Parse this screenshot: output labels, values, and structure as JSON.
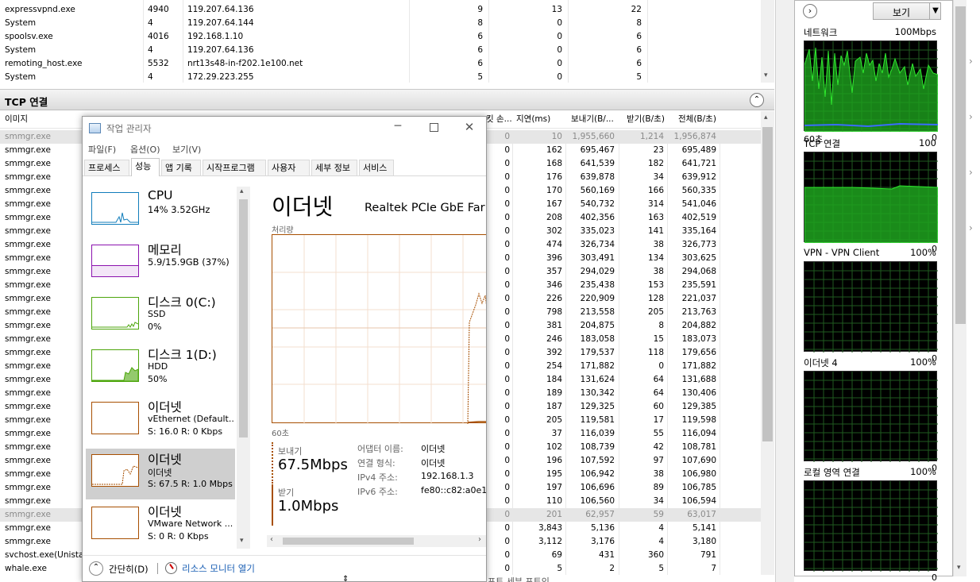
{
  "top_table": {
    "rows": [
      {
        "image": "expressvpnd.exe",
        "pid": "4940",
        "address": "119.207.64.136",
        "c1": "9",
        "c2": "13",
        "c3": "22"
      },
      {
        "image": "System",
        "pid": "4",
        "address": "119.207.64.144",
        "c1": "8",
        "c2": "0",
        "c3": "8"
      },
      {
        "image": "spoolsv.exe",
        "pid": "4016",
        "address": "192.168.1.10",
        "c1": "6",
        "c2": "0",
        "c3": "6"
      },
      {
        "image": "System",
        "pid": "4",
        "address": "119.207.64.136",
        "c1": "6",
        "c2": "0",
        "c3": "6"
      },
      {
        "image": "remoting_host.exe",
        "pid": "5532",
        "address": "nrt13s48-in-f202.1e100.net",
        "c1": "6",
        "c2": "0",
        "c3": "6"
      },
      {
        "image": "System",
        "pid": "4",
        "address": "172.29.223.255",
        "c1": "5",
        "c2": "0",
        "c3": "5"
      }
    ]
  },
  "tcp": {
    "title": "TCP 연결",
    "col_image": "이미지",
    "col_loss": "킷 손...",
    "col_latency": "지연(ms)",
    "col_send": "보내기(B/...",
    "col_recv": "받기(B/초)",
    "col_total": "전체(B/초)",
    "rows": [
      {
        "image": "smmgr.exe",
        "loss": "0",
        "latency": "10",
        "send": "1,955,660",
        "recv": "1,214",
        "total": "1,956,874",
        "dim": true
      },
      {
        "image": "smmgr.exe",
        "loss": "0",
        "latency": "162",
        "send": "695,467",
        "recv": "23",
        "total": "695,489"
      },
      {
        "image": "smmgr.exe",
        "loss": "0",
        "latency": "168",
        "send": "641,539",
        "recv": "182",
        "total": "641,721"
      },
      {
        "image": "smmgr.exe",
        "loss": "0",
        "latency": "176",
        "send": "639,878",
        "recv": "34",
        "total": "639,912"
      },
      {
        "image": "smmgr.exe",
        "loss": "0",
        "latency": "170",
        "send": "560,169",
        "recv": "166",
        "total": "560,335"
      },
      {
        "image": "smmgr.exe",
        "loss": "0",
        "latency": "167",
        "send": "540,732",
        "recv": "314",
        "total": "541,046"
      },
      {
        "image": "smmgr.exe",
        "loss": "0",
        "latency": "208",
        "send": "402,356",
        "recv": "163",
        "total": "402,519"
      },
      {
        "image": "smmgr.exe",
        "loss": "0",
        "latency": "302",
        "send": "335,023",
        "recv": "141",
        "total": "335,164"
      },
      {
        "image": "smmgr.exe",
        "loss": "0",
        "latency": "474",
        "send": "326,734",
        "recv": "38",
        "total": "326,773"
      },
      {
        "image": "smmgr.exe",
        "loss": "0",
        "latency": "396",
        "send": "303,491",
        "recv": "134",
        "total": "303,625"
      },
      {
        "image": "smmgr.exe",
        "loss": "0",
        "latency": "357",
        "send": "294,029",
        "recv": "38",
        "total": "294,068"
      },
      {
        "image": "smmgr.exe",
        "loss": "0",
        "latency": "346",
        "send": "235,438",
        "recv": "153",
        "total": "235,591"
      },
      {
        "image": "smmgr.exe",
        "loss": "0",
        "latency": "226",
        "send": "220,909",
        "recv": "128",
        "total": "221,037"
      },
      {
        "image": "smmgr.exe",
        "loss": "0",
        "latency": "798",
        "send": "213,558",
        "recv": "205",
        "total": "213,763"
      },
      {
        "image": "smmgr.exe",
        "loss": "0",
        "latency": "381",
        "send": "204,875",
        "recv": "8",
        "total": "204,882"
      },
      {
        "image": "smmgr.exe",
        "loss": "0",
        "latency": "246",
        "send": "183,058",
        "recv": "15",
        "total": "183,073"
      },
      {
        "image": "smmgr.exe",
        "loss": "0",
        "latency": "392",
        "send": "179,537",
        "recv": "118",
        "total": "179,656"
      },
      {
        "image": "smmgr.exe",
        "loss": "0",
        "latency": "254",
        "send": "171,882",
        "recv": "0",
        "total": "171,882"
      },
      {
        "image": "smmgr.exe",
        "loss": "0",
        "latency": "184",
        "send": "131,624",
        "recv": "64",
        "total": "131,688"
      },
      {
        "image": "smmgr.exe",
        "loss": "0",
        "latency": "189",
        "send": "130,342",
        "recv": "64",
        "total": "130,406"
      },
      {
        "image": "smmgr.exe",
        "loss": "0",
        "latency": "187",
        "send": "129,325",
        "recv": "60",
        "total": "129,385"
      },
      {
        "image": "smmgr.exe",
        "loss": "0",
        "latency": "205",
        "send": "119,581",
        "recv": "17",
        "total": "119,598"
      },
      {
        "image": "smmgr.exe",
        "loss": "0",
        "latency": "37",
        "send": "116,039",
        "recv": "55",
        "total": "116,094"
      },
      {
        "image": "smmgr.exe",
        "loss": "0",
        "latency": "102",
        "send": "108,739",
        "recv": "42",
        "total": "108,781"
      },
      {
        "image": "smmgr.exe",
        "loss": "0",
        "latency": "196",
        "send": "107,592",
        "recv": "97",
        "total": "107,690"
      },
      {
        "image": "smmgr.exe",
        "loss": "0",
        "latency": "195",
        "send": "106,942",
        "recv": "38",
        "total": "106,980"
      },
      {
        "image": "smmgr.exe",
        "loss": "0",
        "latency": "197",
        "send": "106,696",
        "recv": "89",
        "total": "106,785"
      },
      {
        "image": "smmgr.exe",
        "loss": "0",
        "latency": "110",
        "send": "106,560",
        "recv": "34",
        "total": "106,594"
      },
      {
        "image": "smmgr.exe",
        "loss": "0",
        "latency": "201",
        "send": "62,957",
        "recv": "59",
        "total": "63,017",
        "dim": true
      },
      {
        "image": "smmgr.exe",
        "loss": "0",
        "latency": "3,843",
        "send": "5,136",
        "recv": "4",
        "total": "5,141"
      },
      {
        "image": "smmgr.exe",
        "loss": "0",
        "latency": "3,112",
        "send": "3,176",
        "recv": "4",
        "total": "3,180"
      },
      {
        "image": "svchost.exe(Unistac",
        "loss": "0",
        "latency": "69",
        "send": "431",
        "recv": "360",
        "total": "791"
      },
      {
        "image": "whale.exe",
        "loss": "0",
        "latency": "5",
        "send": "2",
        "recv": "5",
        "total": "7"
      }
    ],
    "footer_partial": "포트 세부 포트인"
  },
  "right_panel": {
    "view_button": "보기",
    "graphs": [
      {
        "title": "네트워크",
        "max": "100Mbps",
        "left_bottom": "60초",
        "min": "0"
      },
      {
        "title": "TCP 연결",
        "max": "100",
        "left_bottom": "",
        "min": "0"
      },
      {
        "title": "VPN - VPN Client",
        "max": "100%",
        "left_bottom": "",
        "min": "0"
      },
      {
        "title": "이더넷 4",
        "max": "100%",
        "left_bottom": "",
        "min": "0"
      },
      {
        "title": "로컬 영역 연결",
        "max": "100%",
        "left_bottom": "",
        "min": "0"
      }
    ]
  },
  "task_manager": {
    "title": "작업 관리자",
    "menu": [
      "파일(F)",
      "옵션(O)",
      "보기(V)"
    ],
    "tabs": [
      "프로세스",
      "성능",
      "앱 기록",
      "시작프로그램",
      "사용자",
      "세부 정보",
      "서비스"
    ],
    "sidebar": [
      {
        "title": "CPU",
        "l1": "14% 3.52GHz",
        "l2": "",
        "l3": "",
        "color": "#117dbb"
      },
      {
        "title": "메모리",
        "l1": "5.9/15.9GB (37%)",
        "l2": "",
        "l3": "",
        "color": "#8b12ae"
      },
      {
        "title": "디스크 0(C:)",
        "l1": "SSD",
        "l2": "0%",
        "l3": "",
        "color": "#4da60c"
      },
      {
        "title": "디스크 1(D:)",
        "l1": "HDD",
        "l2": "50%",
        "l3": "",
        "color": "#4da60c"
      },
      {
        "title": "이더넷",
        "l1": "vEthernet (Default...",
        "l2": "S: 16.0  R: 0 Kbps",
        "l3": "",
        "color": "#a74f01"
      },
      {
        "title": "이더넷",
        "l1": "이더넷",
        "l2": "S: 67.5  R: 1.0 Mbps",
        "l3": "",
        "color": "#a74f01",
        "selected": true
      },
      {
        "title": "이더넷",
        "l1": "VMware Network ...",
        "l2": "S: 0  R: 0 Kbps",
        "l3": "",
        "color": "#a74f01"
      }
    ],
    "detail": {
      "heading": "이더넷",
      "adapter_name": "Realtek PCIe GbE Far",
      "throughput_label": "처리량",
      "time_label": "60초",
      "send_label": "보내기",
      "send_value": "67.5Mbps",
      "recv_label": "받기",
      "recv_value": "1.0Mbps",
      "props": [
        {
          "k": "어댑터 이름:",
          "v": "이더넷"
        },
        {
          "k": "연결 형식:",
          "v": "이더넷"
        },
        {
          "k": "IPv4 주소:",
          "v": "192.168.1.3"
        },
        {
          "k": "IPv6 주소:",
          "v": "fe80::c82:a0e1:"
        }
      ]
    },
    "footer": {
      "collapse": "간단히(D)",
      "resmon": "리소스 모니터 열기"
    },
    "accent": "#a74f01"
  }
}
